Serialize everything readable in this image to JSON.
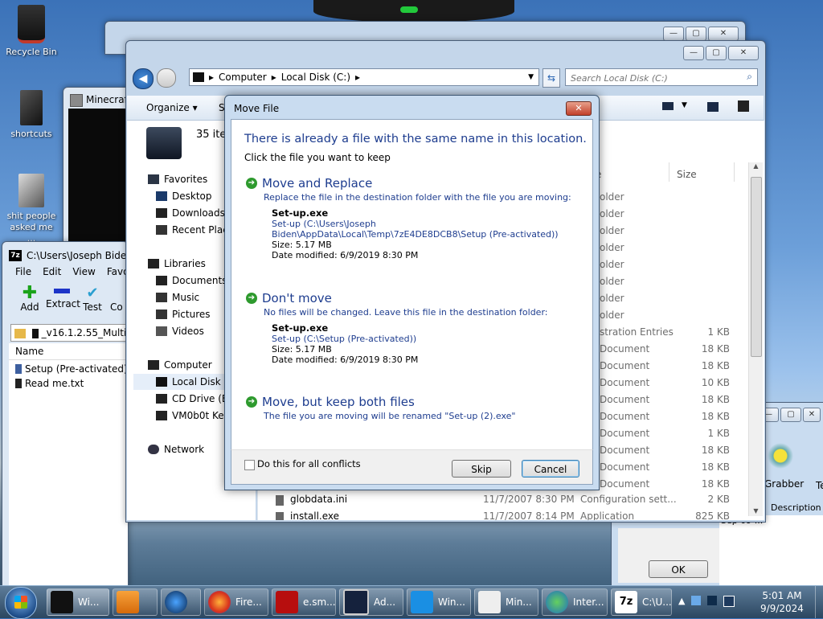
{
  "desktop": {
    "icons": [
      {
        "label": "Recycle Bin"
      },
      {
        "label": "shortcuts"
      },
      {
        "label": "shit people asked me ..."
      }
    ]
  },
  "bg_window": {
    "title": "Minecraf"
  },
  "sevenzip": {
    "title": "C:\\Users\\Joseph Biden\\",
    "menu": [
      "File",
      "Edit",
      "View",
      "Favori"
    ],
    "toolbar": [
      "Add",
      "Extract",
      "Test",
      "Co"
    ],
    "path": "_v16.1.2.55_Multi",
    "col_name": "Name",
    "files": [
      "Setup (Pre-activated)",
      "Read me.txt"
    ]
  },
  "explorer": {
    "breadcrumb": [
      "Computer",
      "Local Disk (C:)"
    ],
    "search_placeholder": "Search Local Disk (C:)",
    "organize": "Organize",
    "cmd_partial": "S",
    "items_count": "35 iter",
    "col_type_partial": "e",
    "col_size": "Size",
    "nav": {
      "favorites": "Favorites",
      "fav_items": [
        "Desktop",
        "Downloads",
        "Recent Place"
      ],
      "libraries": "Libraries",
      "lib_items": [
        "Documents",
        "Music",
        "Pictures",
        "Videos"
      ],
      "computer": "Computer",
      "comp_items": [
        "Local Disk (C",
        "CD Drive (E:)",
        "VM0b0t Kevi"
      ],
      "network": "Network"
    },
    "rows": [
      {
        "type": "older",
        "size": ""
      },
      {
        "type": "older",
        "size": ""
      },
      {
        "type": "older",
        "size": ""
      },
      {
        "type": "older",
        "size": ""
      },
      {
        "type": "older",
        "size": ""
      },
      {
        "type": "older",
        "size": ""
      },
      {
        "type": "older",
        "size": ""
      },
      {
        "type": "older",
        "size": ""
      },
      {
        "type": "stration Entries",
        "size": "1 KB"
      },
      {
        "type": "Document",
        "size": "18 KB"
      },
      {
        "type": "Document",
        "size": "18 KB"
      },
      {
        "type": "Document",
        "size": "10 KB"
      },
      {
        "type": "Document",
        "size": "18 KB"
      },
      {
        "type": "Document",
        "size": "18 KB"
      },
      {
        "type": "Document",
        "size": "1 KB"
      },
      {
        "type": "Document",
        "size": "18 KB"
      },
      {
        "type": "Document",
        "size": "18 KB"
      },
      {
        "type": "Document",
        "size": "18 KB"
      }
    ],
    "bottom_row": {
      "name": "globdata.ini",
      "date": "11/7/2007 8:30 PM",
      "type": "Configuration sett...",
      "size": "2 KB"
    },
    "bottom_row2": {
      "name": "install.exe",
      "date": "11/7/2007 8:14 PM",
      "type": "Application",
      "size": "825 KB"
    }
  },
  "right_window": {
    "grabber_label": "Grabber",
    "te_label": "Te",
    "col_description": "Description",
    "date": "Sep 09 ...",
    "ok": "OK"
  },
  "dialog": {
    "title": "Move File",
    "heading": "There is already a file with the same name in this location.",
    "sub": "Click the file you want to keep",
    "option1": {
      "title": "Move and Replace",
      "desc": "Replace the file in the destination folder with the file you are moving:",
      "file": "Set-up.exe",
      "path1": "Set-up (C:\\Users\\Joseph",
      "path2": "Biden\\AppData\\Local\\Temp\\7zE4DE8DCB8\\Setup (Pre-activated))",
      "size": "Size: 5.17 MB",
      "modified": "Date modified: 6/9/2019 8:30 PM"
    },
    "option2": {
      "title": "Don't move",
      "desc": "No files will be changed. Leave this file in the destination folder:",
      "file": "Set-up.exe",
      "path1": "Set-up (C:\\Setup (Pre-activated))",
      "size": "Size: 5.17 MB",
      "modified": "Date modified: 6/9/2019 8:30 PM"
    },
    "option3": {
      "title": "Move, but keep both files",
      "desc": "The file you are moving will be renamed \"Set-up (2).exe\""
    },
    "checkbox": "Do this for all conflicts",
    "skip": "Skip",
    "cancel": "Cancel"
  },
  "taskbar": {
    "items": [
      {
        "label": "Wi..."
      },
      {
        "label": ""
      },
      {
        "label": ""
      },
      {
        "label": "Fire..."
      },
      {
        "label": "e.sm..."
      },
      {
        "label": "Ad..."
      },
      {
        "label": "Win..."
      },
      {
        "label": "Min..."
      },
      {
        "label": "Inter..."
      },
      {
        "label": "C:\\U..."
      }
    ],
    "time": "5:01 AM",
    "date": "9/9/2024"
  }
}
